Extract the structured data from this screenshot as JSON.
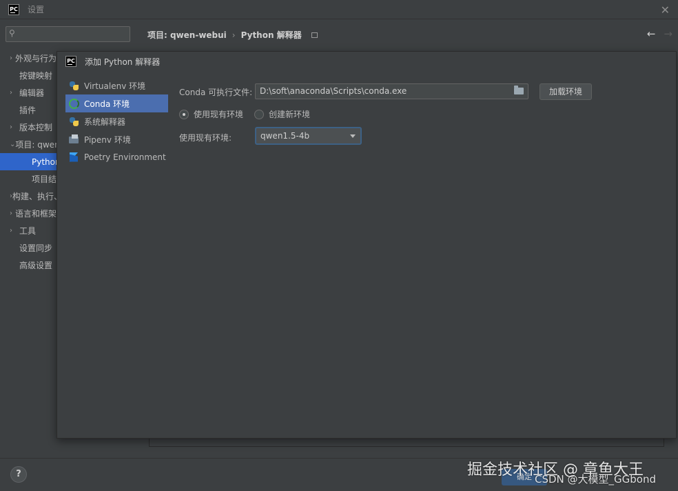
{
  "window": {
    "title": "设置",
    "logo_text": "PC"
  },
  "search": {
    "placeholder": ""
  },
  "breadcrumb": {
    "project": "项目: qwen-webui",
    "separator": "›",
    "page": "Python 解释器"
  },
  "sidebar": {
    "items": [
      {
        "label": "外观与行为",
        "arrow": "›",
        "has_arrow": true
      },
      {
        "label": "按键映射",
        "has_arrow": false
      },
      {
        "label": "编辑器",
        "arrow": "›",
        "has_arrow": true
      },
      {
        "label": "插件",
        "has_arrow": false
      },
      {
        "label": "版本控制",
        "arrow": "›",
        "has_arrow": true
      },
      {
        "label": "项目: qwen-webui",
        "arrow": "⌄",
        "has_arrow": true
      },
      {
        "label": "Python 解释器",
        "child": true,
        "selected": true
      },
      {
        "label": "项目结构",
        "child": true
      },
      {
        "label": "构建、执行、部署",
        "arrow": "›",
        "has_arrow": true
      },
      {
        "label": "语言和框架",
        "arrow": "›",
        "has_arrow": true
      },
      {
        "label": "工具",
        "arrow": "›",
        "has_arrow": true
      },
      {
        "label": "设置同步",
        "has_arrow": false
      },
      {
        "label": "高级设置",
        "has_arrow": false
      }
    ]
  },
  "dialog": {
    "title": "添加 Python 解释器",
    "logo_text": "PC",
    "types": [
      {
        "label": "Virtualenv 环境",
        "icon": "python-icon"
      },
      {
        "label": "Conda 环境",
        "icon": "conda-icon",
        "selected": true
      },
      {
        "label": "系统解释器",
        "icon": "python-icon"
      },
      {
        "label": "Pipenv 环境",
        "icon": "pipenv-icon"
      },
      {
        "label": "Poetry Environment",
        "icon": "poetry-icon"
      }
    ],
    "conda_label": "Conda 可执行文件:",
    "conda_path": "D:\\soft\\anaconda\\Scripts\\conda.exe",
    "load_button": "加载环境",
    "radio_existing": "使用现有环境",
    "radio_new": "创建新环境",
    "existing_env_label": "使用现有环境:",
    "existing_env_value": "qwen1.5-4b"
  },
  "footer": {
    "help": "?",
    "ok_button": "确定"
  },
  "watermark": {
    "line1": "掘金技术社区 @ 章鱼大王",
    "line2": "CSDN @大模型_GGbond"
  },
  "colors": {
    "background": "#3c3f41",
    "selection": "#2f65ca",
    "dialog_selection": "#4b6eaf",
    "focus_border": "#3d6185"
  }
}
